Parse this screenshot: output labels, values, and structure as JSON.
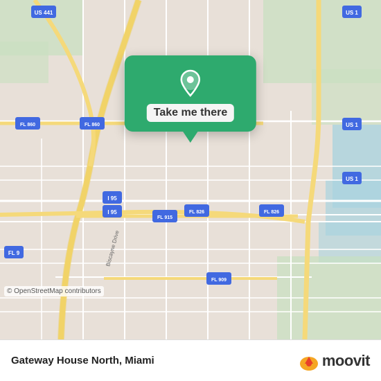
{
  "map": {
    "attribution": "© OpenStreetMap contributors",
    "background_color": "#e8e0d8",
    "road_color": "#ffffff",
    "highway_color": "#f5d97a",
    "green_area_color": "#b5d5a0",
    "water_color": "#aad3df"
  },
  "popup": {
    "button_label": "Take me there",
    "background_color": "#2eaa6e",
    "pin_color": "#ffffff"
  },
  "bottom_bar": {
    "location_name": "Gateway House North, Miami",
    "moovit_text": "moovit"
  },
  "road_labels": [
    "US 441",
    "US 1",
    "FL 860",
    "FL 826",
    "FL 915",
    "FL 909",
    "I 95",
    "FL 9",
    "I 95"
  ]
}
